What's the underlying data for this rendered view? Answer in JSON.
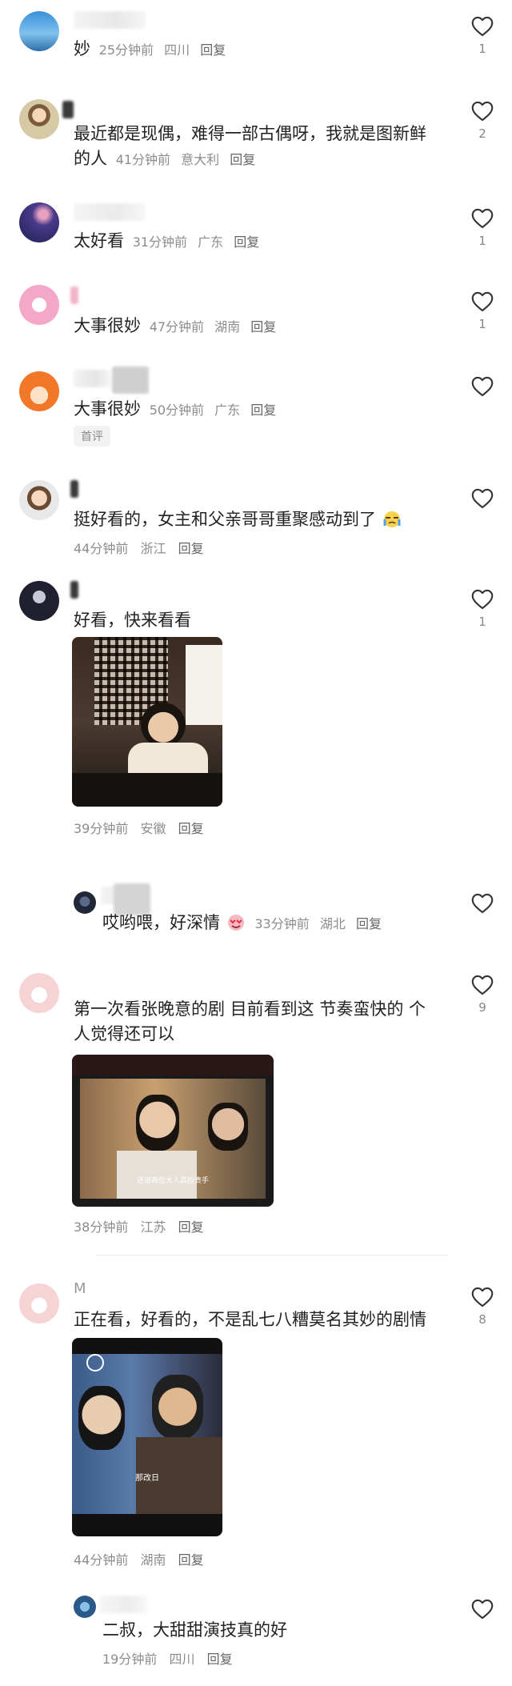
{
  "comments": [
    {
      "text": "妙",
      "time": "25分钟前",
      "location": "四川",
      "reply": "回复",
      "likes": "1"
    },
    {
      "text_line1": "最近都是现偶，难得一部古偶呀，我就是图新鲜",
      "text_line2": "的人",
      "time": "41分钟前",
      "location": "意大利",
      "reply": "回复",
      "likes": "2"
    },
    {
      "text": "太好看",
      "time": "31分钟前",
      "location": "广东",
      "reply": "回复",
      "likes": "1"
    },
    {
      "text": "大事很妙",
      "time": "47分钟前",
      "location": "湖南",
      "reply": "回复",
      "likes": "1"
    },
    {
      "text": "大事很妙",
      "time": "50分钟前",
      "location": "广东",
      "reply": "回复",
      "badge": "首评"
    },
    {
      "text": "挺好看的，女主和父亲哥哥重聚感动到了",
      "time": "44分钟前",
      "location": "浙江",
      "reply": "回复"
    },
    {
      "text": "好看，快来看看",
      "time": "39分钟前",
      "location": "安徽",
      "reply": "回复",
      "likes": "1"
    },
    {
      "text": "哎哟喂，好深情",
      "time": "33分钟前",
      "location": "湖北",
      "reply": "回复"
    },
    {
      "text_line1": "第一次看张晚意的剧 目前看到这 节奏蛮快的 个",
      "text_line2": "人觉得还可以",
      "time": "38分钟前",
      "location": "江苏",
      "reply": "回复",
      "likes": "9",
      "subtitle": "还请两位大人高抬贵手"
    },
    {
      "name_initial": "M",
      "text": "正在看，好看的，不是乱七八糟莫名其妙的剧情",
      "time": "44分钟前",
      "location": "湖南",
      "reply": "回复",
      "likes": "8",
      "subtitle": "那改日"
    },
    {
      "text": "二叔，大甜甜演技真的好",
      "time": "19分钟前",
      "location": "四川",
      "reply": "回复"
    }
  ],
  "colors": {
    "text": "#222222",
    "meta": "#8c8c8c",
    "icon": "#333333",
    "badge_bg": "#f2f2f2"
  }
}
